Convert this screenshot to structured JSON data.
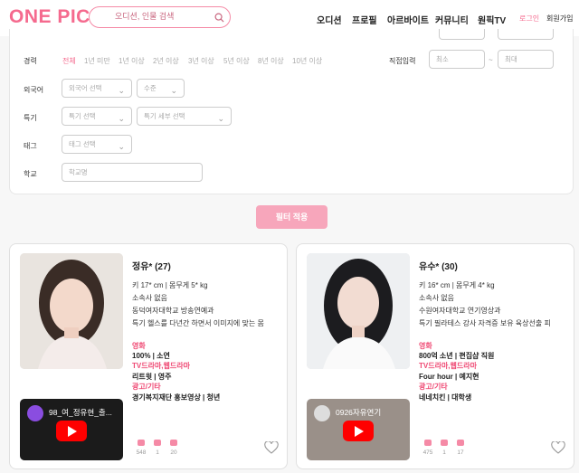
{
  "header": {
    "logo": "ONE PICK.",
    "search_placeholder": "오디션, 인물 검색",
    "nav": [
      "오디션",
      "프로필",
      "아르바이트",
      "커뮤니티",
      "원픽TV"
    ],
    "login": "로그인",
    "signup": "회원가입"
  },
  "filters": {
    "career": {
      "label": "경력",
      "chips": [
        "전체",
        "1년 미만",
        "1년 이상",
        "2년 이상",
        "3년 이상",
        "5년 이상",
        "8년 이상",
        "10년 이상"
      ],
      "selected": "전체",
      "direct_label": "직접입력",
      "min_placeholder": "최소",
      "max_placeholder": "최대",
      "range_sep": "~"
    },
    "language": {
      "label": "외국어",
      "select": "외국어 선택",
      "level": "수준"
    },
    "skill": {
      "label": "특기",
      "select": "특기 선택",
      "detail": "특기 세부 선택"
    },
    "tag": {
      "label": "태그",
      "select": "태그 선택"
    },
    "school": {
      "label": "학교",
      "placeholder": "학교명"
    }
  },
  "apply_button": "필터 적용",
  "profiles": [
    {
      "name": "정유* (27)",
      "body": "키 17* cm | 몸무게 5* kg",
      "agency": "소속사 없음",
      "school": "동덕여자대학교 방송연예과",
      "special": "특기 헬스를 다년간 하면서 이미지에 맞는 몸",
      "categories": [
        {
          "cat": "영화",
          "value": "100% | 소연"
        },
        {
          "cat": "TV드라마,웹드라마",
          "value": "리트윗 | 영주"
        },
        {
          "cat": "광고/기타",
          "value": "경기복지재단 홍보영상 | 청년"
        }
      ],
      "video_title": "98_여_정유현_출...",
      "stats": [
        "548",
        "1",
        "20"
      ]
    },
    {
      "name": "유수* (30)",
      "body": "키 16* cm | 몸무게 4* kg",
      "agency": "소속사 없음",
      "school": "수원여자대학교 연기영상과",
      "special": "특기 필라테스 강사 자격증 보유 육상선출 피",
      "categories": [
        {
          "cat": "영화",
          "value": "800억 소년 | 편집샵 직원"
        },
        {
          "cat": "TV드라마,웹드라마",
          "value": "Four hour | 예지현"
        },
        {
          "cat": "광고/기타",
          "value": "네네치킨 | 대학생"
        }
      ],
      "video_title": "0926자유연기",
      "stats": [
        "475",
        "1",
        "17"
      ]
    }
  ],
  "colors": {
    "brand": "#f56a8e",
    "accent": "#ef4a74",
    "apply": "#f7a6bb"
  }
}
